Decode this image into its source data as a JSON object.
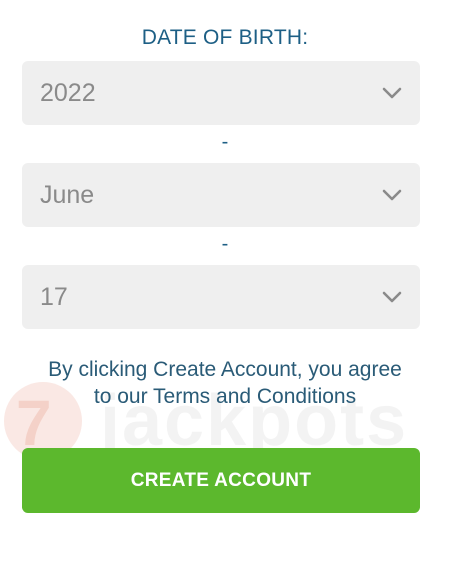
{
  "colors": {
    "title": "#1d5f85",
    "field_bg": "#efefef",
    "field_text": "#8a8a8a",
    "chevron": "#8a8a8a",
    "terms": "#2a5b77",
    "button_bg": "#5cb82d"
  },
  "form": {
    "title": "DATE OF BIRTH:",
    "separator": "-",
    "year": {
      "value": "2022",
      "icon": "chevron-down-icon"
    },
    "month": {
      "value": "June",
      "icon": "chevron-down-icon"
    },
    "day": {
      "value": "17",
      "icon": "chevron-down-icon"
    }
  },
  "terms": {
    "line1": "By clicking Create Account, you agree",
    "line2_prefix": "to our ",
    "link": "Terms and Conditions"
  },
  "watermark": {
    "mark": "7",
    "text": "jackpots"
  },
  "actions": {
    "create_account": "CREATE ACCOUNT"
  }
}
